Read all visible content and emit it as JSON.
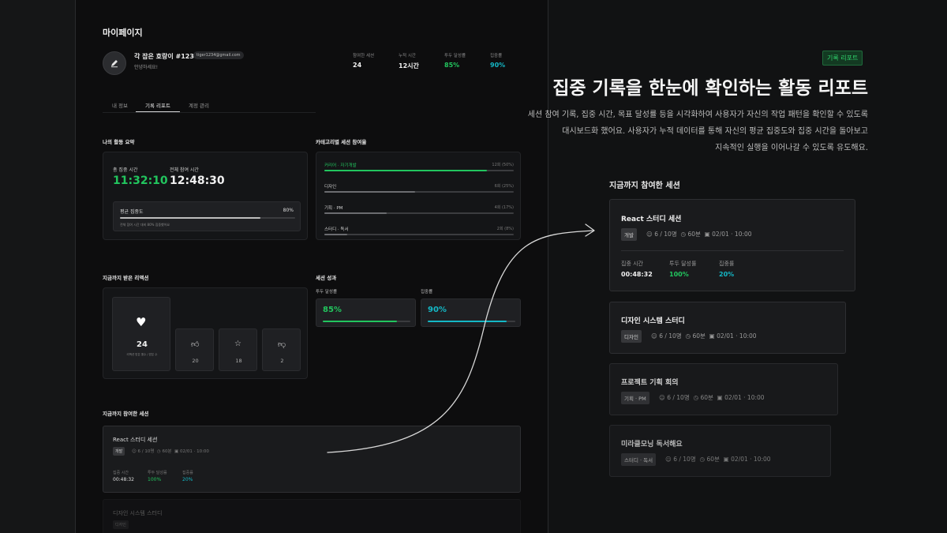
{
  "app": {
    "page_title": "마이페이지",
    "profile": {
      "nickname": "각 잡은 호랑이 #1234",
      "email": "tiger1234@gmail.com",
      "greeting": "안녕하세요!"
    },
    "stats": [
      {
        "label": "참여한 세션",
        "value": "24"
      },
      {
        "label": "누적 시간",
        "value": "12시간"
      },
      {
        "label": "투두 달성률",
        "value": "85%"
      },
      {
        "label": "집중률",
        "value": "90%"
      }
    ],
    "tabs": [
      "내 정보",
      "기록 리포트",
      "계정 관리"
    ],
    "activity": {
      "title": "나의 활동 요약",
      "focus_label": "총 집중 시간",
      "focus_value": "11:32:10",
      "total_label": "전체 참여 시간",
      "total_value": "12:48:30",
      "avg_label": "평균 집중도",
      "avg_value": "80%",
      "avg_note": "전체 참여 시간 대비 80% 집중했어요",
      "avg_level": 0.8
    },
    "category": {
      "title": "카테고리별 세션 참여율",
      "items": [
        {
          "name": "커리어 · 자기개발",
          "count": "12회 (50%)",
          "level": 0.86,
          "color": "#22c55e"
        },
        {
          "name": "디자인",
          "count": "6회 (25%)",
          "level": 0.48,
          "color": "#6b6c70"
        },
        {
          "name": "기획 · PM",
          "count": "4회 (17%)",
          "level": 0.33,
          "color": "#6b6c70"
        },
        {
          "name": "스터디 · 독서",
          "count": "2회 (8%)",
          "level": 0.12,
          "color": "#6b6c70"
        }
      ]
    },
    "reactions": {
      "title": "지금까지 받은 리액션",
      "main_count": "24",
      "main_note": "리액션 받은 횟수 / 받은 수",
      "others": [
        "20",
        "18",
        "2"
      ]
    },
    "results": {
      "title": "세션 성과",
      "todo_label": "투두 달성률",
      "todo_value": "85%",
      "todo_level": 0.85,
      "focus_label": "집중률",
      "focus_value": "90%",
      "focus_level": 0.9
    },
    "sessions": {
      "title": "지금까지 참여한 세션",
      "items": [
        {
          "title": "React 스터디 세션",
          "tag": "개발",
          "people": "6 / 10명",
          "duration": "60분",
          "date": "02/01 · 10:00",
          "m1_label": "집중 시간",
          "m1_value": "00:48:32",
          "m2_label": "투두 달성률",
          "m2_value": "100%",
          "m3_label": "집중률",
          "m3_value": "20%"
        },
        {
          "title": "디자인 시스템 스터디",
          "tag": "디자인"
        }
      ]
    }
  },
  "promo": {
    "badge": "기록 리포트",
    "headline": "집중 기록을 한눈에 확인하는 활동 리포트",
    "desc_line1": "세션 참여 기록, 집중 시간, 목표 달성률 등을 시각화하여 사용자가 자신의 작업 패턴을 확인할 수 있도록",
    "desc_line2": "대시보드화 했어요. 사용자가 누적 데이터를 통해 자신의 평균 집중도와 집중 시간을 돌아보고",
    "desc_line3": "지속적인 실행을 이어나갈 수 있도록 유도해요.",
    "section_title": "지금까지 참여한 세션",
    "sessions": [
      {
        "title": "React 스터디 세션",
        "tag": "개발",
        "people": "6 / 10명",
        "duration": "60분",
        "date": "02/01 · 10:00",
        "m1_label": "집중 시간",
        "m1_value": "00:48:32",
        "m2_label": "투두 달성률",
        "m2_value": "100%",
        "m3_label": "집중률",
        "m3_value": "20%"
      },
      {
        "title": "디자인 시스템 스터디",
        "tag": "디자인",
        "people": "6 / 10명",
        "duration": "60분",
        "date": "02/01 · 10:00"
      },
      {
        "title": "프로젝트 기획 회의",
        "tag": "기획 · PM",
        "people": "6 / 10명",
        "duration": "60분",
        "date": "02/01 · 10:00"
      },
      {
        "title": "미라클모닝 독서해요",
        "tag": "스터디 · 독서",
        "people": "6 / 10명",
        "duration": "60분",
        "date": "02/01 · 10:00"
      }
    ]
  },
  "colors": {
    "accent_green": "#22c55e",
    "accent_cyan": "#14b8c6",
    "bg": "#111213"
  }
}
